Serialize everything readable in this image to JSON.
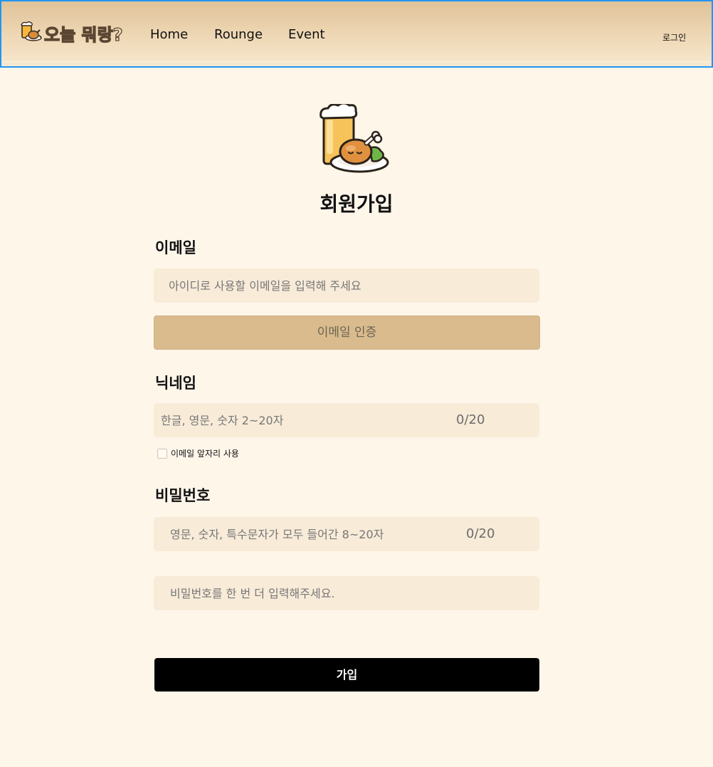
{
  "header": {
    "logo_text": "오늘 뭐랑?",
    "logo_icon": "beer-chicken-icon",
    "nav": [
      {
        "label": "Home"
      },
      {
        "label": "Rounge"
      },
      {
        "label": "Event"
      }
    ],
    "login_label": "로그인",
    "border_color": "#2196f3"
  },
  "hero": {
    "icon": "beer-chicken-illustration",
    "title": "회원가입"
  },
  "email": {
    "label": "이메일",
    "placeholder": "아이디로 사용할 이메일을 입력해 주세요",
    "value": "",
    "verify_button": "이메일 인증"
  },
  "nickname": {
    "label": "닉네임",
    "placeholder": "한글, 영문, 숫자 2~20자",
    "value": "",
    "counter": "0/20",
    "use_email_checkbox_label": "이메일 앞자리 사용",
    "use_email_checked": false
  },
  "password": {
    "label": "비밀번호",
    "placeholder": "영문, 숫자, 특수문자가 모두 들어간 8~20자",
    "value": "",
    "counter": "0/20",
    "confirm_placeholder": "비밀번호를 한 번 더 입력해주세요.",
    "confirm_value": ""
  },
  "submit_label": "가입",
  "colors": {
    "page_bg": "#fff6ea",
    "field_bg": "#f8ebd8",
    "verify_bg": "#d9bb8d",
    "submit_bg": "#000000",
    "header_gradient_top": "#dfc39a"
  }
}
